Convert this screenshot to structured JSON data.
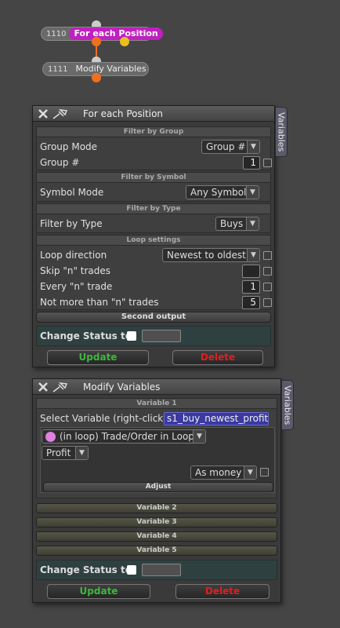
{
  "graph": {
    "node_for_each": {
      "id": "1110",
      "label": "For each Position"
    },
    "node_modify": {
      "id": "1111",
      "label": "Modify Variables"
    },
    "colors": {
      "for_each_label": "#c020c0",
      "wire": "#f07020",
      "pin_yellow": "#e8c020"
    }
  },
  "panel1": {
    "title": "For each Position",
    "side_tab": "Variables",
    "filter_group": {
      "header": "Filter by Group",
      "group_mode_label": "Group Mode",
      "group_mode_value": "Group #",
      "group_num_label": "Group #",
      "group_num_value": "1"
    },
    "filter_symbol": {
      "header": "Filter by Symbol",
      "symbol_mode_label": "Symbol Mode",
      "symbol_mode_value": "Any Symbol"
    },
    "filter_type": {
      "header": "Filter by Type",
      "label": "Filter by Type",
      "value": "Buys"
    },
    "loop": {
      "header": "Loop settings",
      "direction_label": "Loop direction",
      "direction_value": "Newest to oldest",
      "skip_label": "Skip \"n\" trades",
      "skip_value": "",
      "every_label": "Every \"n\" trade",
      "every_value": "1",
      "max_label": "Not more than \"n\" trades",
      "max_value": "5"
    },
    "second_output": "Second output",
    "change_status": "Change Status to",
    "update": "Update",
    "delete": "Delete"
  },
  "panel2": {
    "title": "Modify Variables",
    "side_tab": "Variables",
    "variable1": {
      "header": "Variable 1",
      "select_label": "Select Variable (right-click)",
      "select_value": "s1_buy_newest_profit",
      "source_value": "(in loop) Trade/Order in Loop",
      "field_value": "Profit",
      "format_value": "As money",
      "adjust": "Adjust"
    },
    "variables": [
      "Variable 2",
      "Variable 3",
      "Variable 4",
      "Variable 5"
    ],
    "change_status": "Change Status to",
    "update": "Update",
    "delete": "Delete"
  },
  "icons": [
    "close-icon",
    "pin-icon",
    "dropdown-arrow-icon"
  ]
}
